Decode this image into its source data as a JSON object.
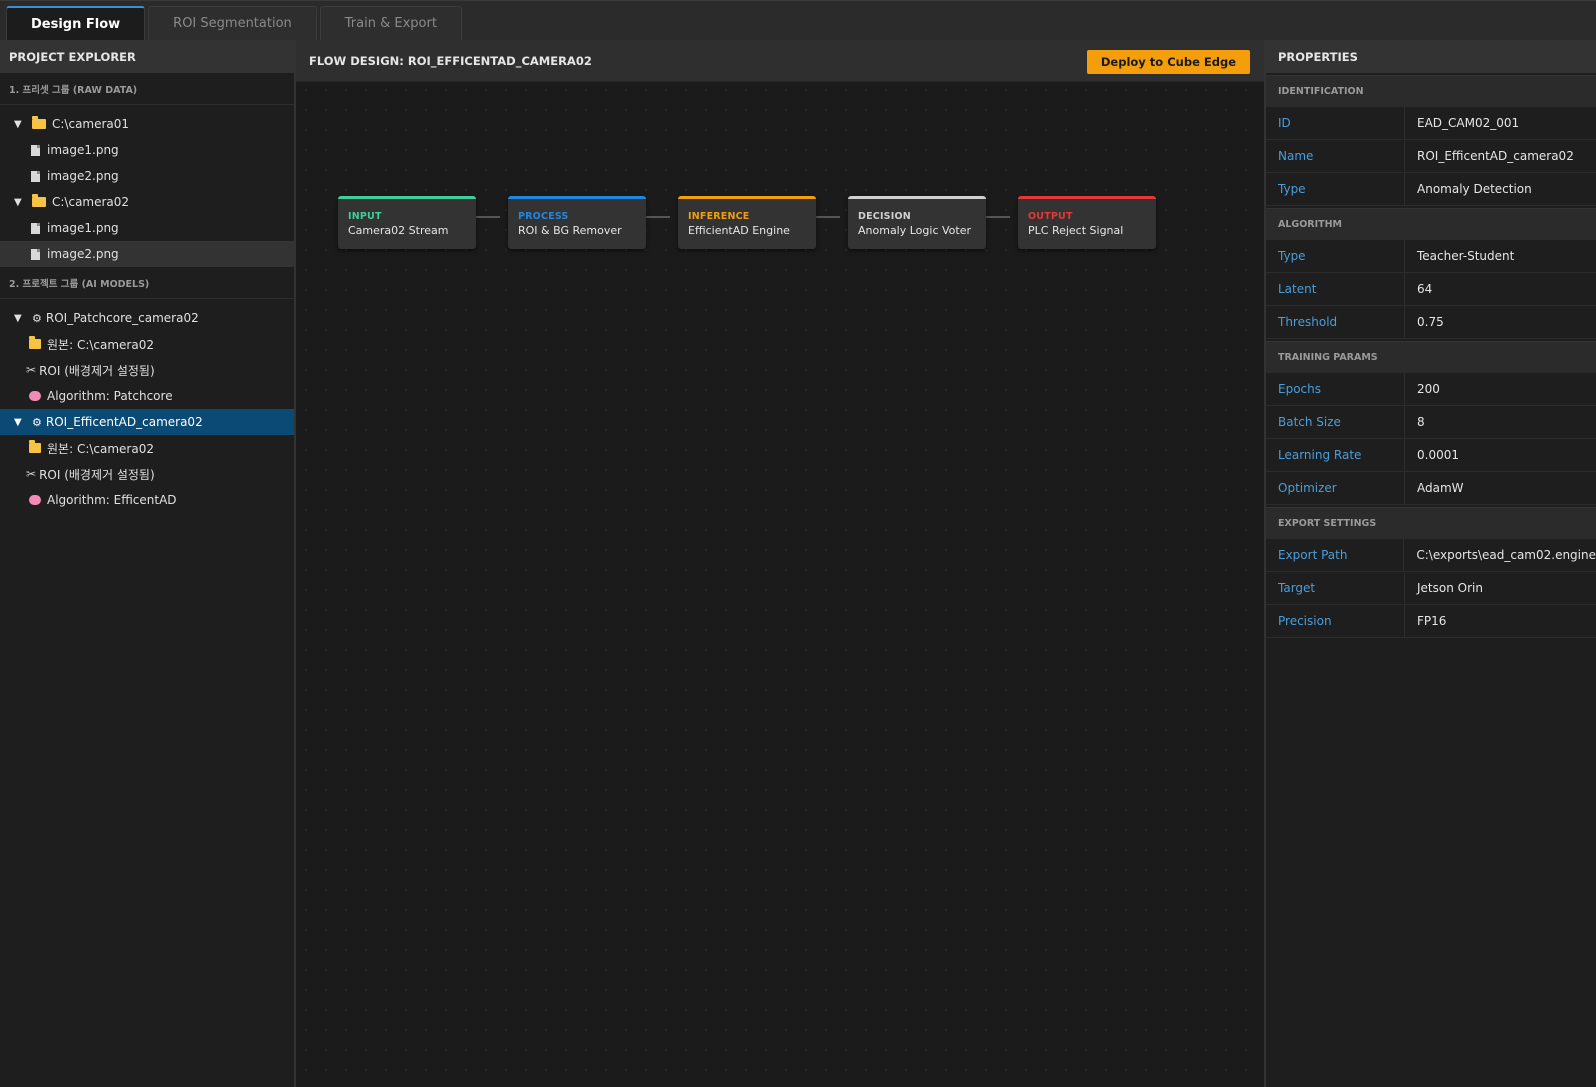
{
  "tabs": [
    {
      "label": "Design Flow",
      "active": true
    },
    {
      "label": "ROI Segmentation",
      "active": false
    },
    {
      "label": "Train & Export",
      "active": false
    }
  ],
  "explorer": {
    "title": "PROJECT EXPLORER",
    "group1": "1. 프리셋 그룹 (RAW DATA)",
    "group2": "2. 프로젝트 그룹 (AI MODELS)",
    "folders": [
      {
        "name": "C:\\camera01",
        "files": [
          "image1.png",
          "image2.png"
        ]
      },
      {
        "name": "C:\\camera02",
        "files": [
          "image1.png",
          "image2.png"
        ]
      }
    ],
    "projects": [
      {
        "name": "ROI_Patchcore_camera02",
        "source": "원본: C:\\camera02",
        "roi": "ROI (배경제거 설정됨)",
        "algorithm": "Algorithm: Patchcore"
      },
      {
        "name": "ROI_EfficentAD_camera02",
        "source": "원본: C:\\camera02",
        "roi": "ROI (배경제거 설정됨)",
        "algorithm": "Algorithm: EfficentAD"
      }
    ]
  },
  "flow": {
    "title": "FLOW DESIGN: ROI_EFFICENTAD_CAMERA02",
    "deploy_label": "Deploy to Cube Edge",
    "nodes": [
      {
        "type": "INPUT",
        "name": "Camera02 Stream",
        "color": "#3ecf9a"
      },
      {
        "type": "PROCESS",
        "name": "ROI & BG Remover",
        "color": "#1e88e5"
      },
      {
        "type": "INFERENCE",
        "name": "EfficientAD Engine",
        "color": "#f59e0b"
      },
      {
        "type": "DECISION",
        "name": "Anomaly Logic Voter",
        "color": "#d0d0d0"
      },
      {
        "type": "OUTPUT",
        "name": "PLC Reject Signal",
        "color": "#e53935"
      }
    ]
  },
  "properties": {
    "title": "PROPERTIES",
    "identification": {
      "head": "IDENTIFICATION",
      "rows": [
        {
          "key": "ID",
          "value": "EAD_CAM02_001"
        },
        {
          "key": "Name",
          "value": "ROI_EfficentAD_camera02"
        },
        {
          "key": "Type",
          "value": "Anomaly Detection"
        }
      ]
    },
    "algorithm": {
      "head": "ALGORITHM",
      "rows": [
        {
          "key": "Type",
          "value": "Teacher-Student"
        },
        {
          "key": "Latent",
          "value": "64"
        },
        {
          "key": "Threshold",
          "value": "0.75"
        }
      ]
    },
    "training": {
      "head": "TRAINING PARAMS",
      "rows": [
        {
          "key": "Epochs",
          "value": "200"
        },
        {
          "key": "Batch Size",
          "value": "8"
        },
        {
          "key": "Learning Rate",
          "value": "0.0001"
        },
        {
          "key": "Optimizer",
          "value": "AdamW"
        }
      ]
    },
    "export": {
      "head": "EXPORT SETTINGS",
      "rows": [
        {
          "key": "Export Path",
          "value": "C:\\exports\\ead_cam02.engine"
        },
        {
          "key": "Target",
          "value": "Jetson Orin"
        },
        {
          "key": "Precision",
          "value": "FP16"
        }
      ]
    }
  }
}
